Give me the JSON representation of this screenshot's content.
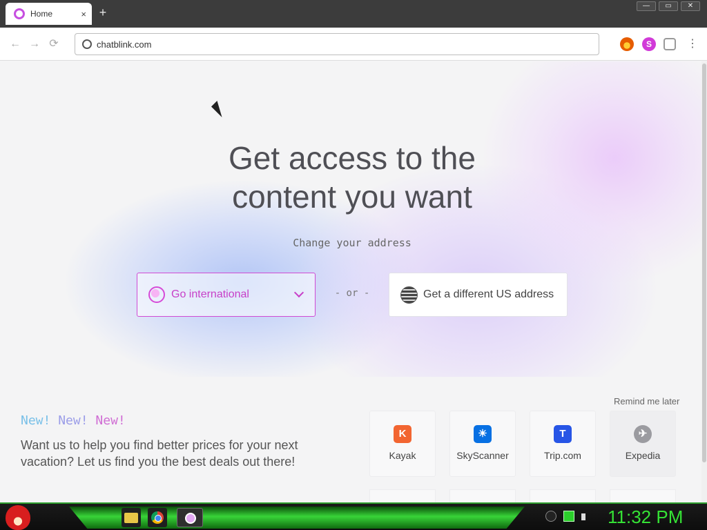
{
  "browser": {
    "tab": {
      "title": "Home",
      "close": "×"
    },
    "new_tab": "+",
    "window_buttons": {
      "minimize": "—",
      "restore": "▭",
      "close": "✕"
    },
    "nav": {
      "back": "←",
      "forward": "→",
      "reload": "⟳"
    },
    "address": "chatblink.com",
    "extensions": {
      "s_label": "S",
      "menu": "⋮"
    }
  },
  "hero": {
    "headline_line1": "Get access to the",
    "headline_line2": "content you want",
    "subhead": "Change your address",
    "go_international": "Go international",
    "separator": "- or -",
    "us_address": "Get a different US address"
  },
  "promo": {
    "new_words": [
      "New!",
      "New!",
      "New!"
    ],
    "description": "Want us to help you find better prices for your next vacation? Let us find you the best deals out there!",
    "remind": "Remind me later",
    "cards": [
      {
        "name": "Kayak",
        "logo": "K",
        "color": "#f26531"
      },
      {
        "name": "SkyScanner",
        "logo": "☀",
        "color": "#0770e3"
      },
      {
        "name": "Trip.com",
        "logo": "T",
        "color": "#2755e6"
      },
      {
        "name": "Expedia",
        "logo": "✈",
        "color": "#9b9ba0"
      }
    ]
  },
  "taskbar": {
    "clock": "11:32 PM"
  },
  "colors": {
    "accent": "#c73fc8",
    "taskbar_green": "#35e335"
  },
  "icons": [
    "globe-icon",
    "chevron-down-icon",
    "flag-icon",
    "folder-icon",
    "chrome-icon",
    "gear-icon"
  ]
}
